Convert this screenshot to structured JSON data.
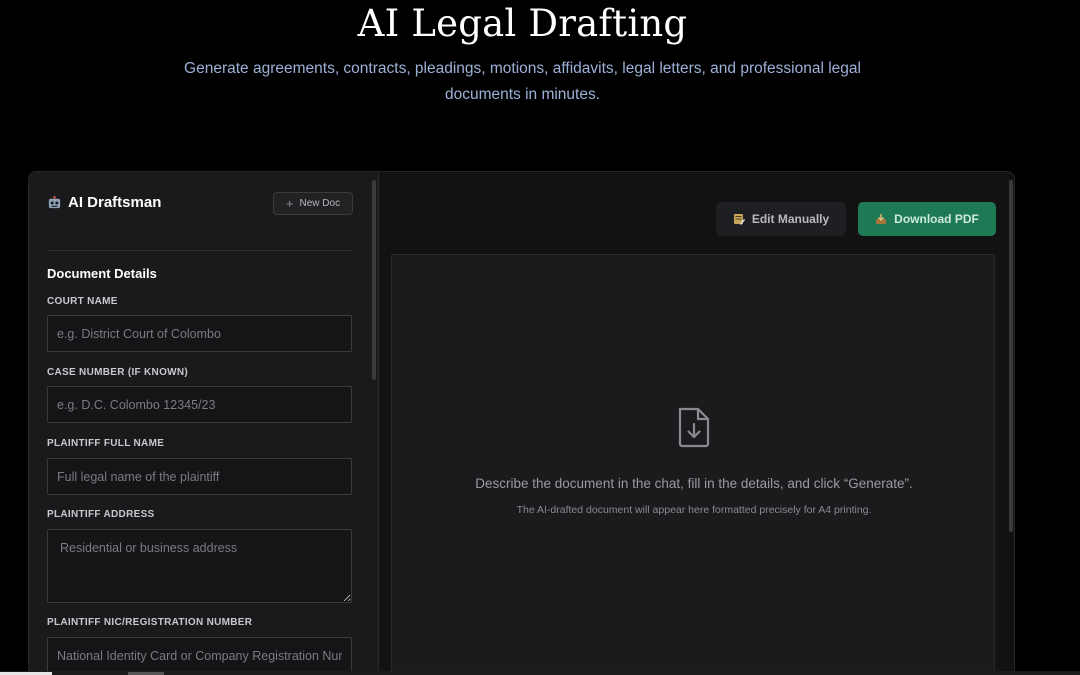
{
  "hero": {
    "title": "AI Legal Drafting",
    "subtitle": "Generate agreements, contracts, pleadings, motions, affidavits, legal letters, and professional legal documents in minutes."
  },
  "sidebar": {
    "brand": "AI Draftsman",
    "brand_icon": "robot-icon",
    "new_doc_label": "New Doc",
    "section_title": "Document Details",
    "fields": [
      {
        "label": "COURT NAME",
        "placeholder": "e.g. District Court of Colombo",
        "value": ""
      },
      {
        "label": "CASE NUMBER (IF KNOWN)",
        "placeholder": "e.g. D.C. Colombo 12345/23",
        "value": ""
      },
      {
        "label": "PLAINTIFF FULL NAME",
        "placeholder": "Full legal name of the plaintiff",
        "value": ""
      },
      {
        "label": "PLAINTIFF ADDRESS",
        "placeholder": "Residential or business address",
        "value": ""
      },
      {
        "label": "PLAINTIFF NIC/REGISTRATION NUMBER",
        "placeholder": "National Identity Card or Company Registration Number",
        "value": ""
      }
    ]
  },
  "toolbar": {
    "edit_label": "Edit Manually",
    "edit_icon": "memo-icon",
    "download_label": "Download PDF",
    "download_icon": "inbox-tray-icon"
  },
  "preview": {
    "icon": "file-download-icon",
    "message": "Describe the document in the chat, fill in the details, and click “Generate”.",
    "hint": "The AI-drafted document will appear here formatted precisely for A4 printing."
  },
  "colors": {
    "background": "#000000",
    "panel": "#121212",
    "sidebar": "#1a1a1c",
    "accent_green": "#1d7a55",
    "subtitle_blue": "#9cb1d6"
  }
}
